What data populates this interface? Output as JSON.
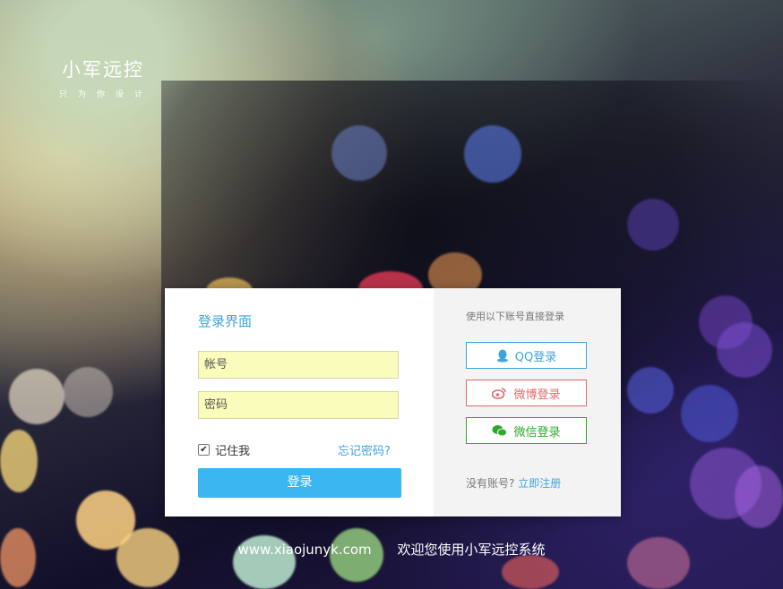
{
  "brand": {
    "title": "小军远控",
    "subtitle": "只为你设计"
  },
  "login": {
    "title": "登录界面",
    "account_placeholder": "帐号",
    "password_placeholder": "密码",
    "remember_label": "记住我",
    "remember_checked": true,
    "forgot_label": "忘记密码?",
    "submit_label": "登录"
  },
  "social": {
    "hint": "使用以下账号直接登录",
    "qq_label": "QQ登录",
    "weibo_label": "微博登录",
    "wechat_label": "微信登录",
    "no_account_text": "没有账号?",
    "register_label": "立即注册",
    "icons": [
      "qq-icon",
      "weibo-icon",
      "wechat-icon"
    ],
    "colors": {
      "qq": "#3fa4dc",
      "weibo": "#e06a6a",
      "wechat": "#2ea72a"
    }
  },
  "footer": {
    "url": "www.xiaojunyk.com",
    "welcome": "欢迎您使用小军远控系统"
  },
  "colors": {
    "accent": "#3fa4dc",
    "button": "#3bb6f0",
    "input_bg": "#fafcbc"
  }
}
